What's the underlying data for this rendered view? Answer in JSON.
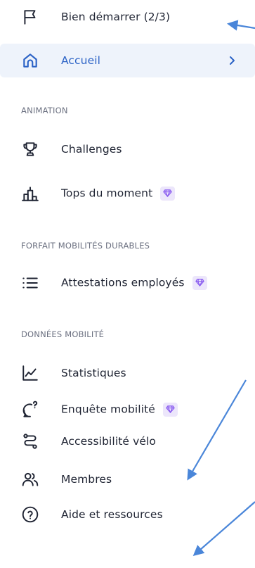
{
  "nav": {
    "getting_started": {
      "label": "Bien démarrer (2/3)",
      "icon": "flag-icon"
    },
    "home": {
      "label": "Accueil",
      "icon": "home-icon",
      "active": true
    },
    "sections": {
      "animation": "ANIMATION",
      "forfait": "FORFAIT MOBILITÉS DURABLES",
      "donnees": "DONNÉES MOBILITÉ"
    },
    "items": [
      {
        "label": "Challenges",
        "icon": "trophy-icon",
        "premium": false
      },
      {
        "label": "Tops du moment",
        "icon": "podium-icon",
        "premium": true
      },
      {
        "label": "Attestations employés",
        "icon": "list-icon",
        "premium": true
      },
      {
        "label": "Statistiques",
        "icon": "line-chart-icon",
        "premium": false
      },
      {
        "label": "Enquête mobilité",
        "icon": "survey-icon",
        "premium": true
      },
      {
        "label": "Accessibilité vélo",
        "icon": "route-icon",
        "premium": false
      },
      {
        "label": "Membres",
        "icon": "users-icon",
        "premium": false
      },
      {
        "label": "Aide et ressources",
        "icon": "help-icon",
        "premium": false
      }
    ]
  },
  "colors": {
    "active_bg": "#eef3fb",
    "active_text": "#2c63c6",
    "premium_badge_bg": "#ece6fb",
    "premium_badge_icon": "#8a5cf0",
    "annotation_arrow": "#4a86d9"
  }
}
